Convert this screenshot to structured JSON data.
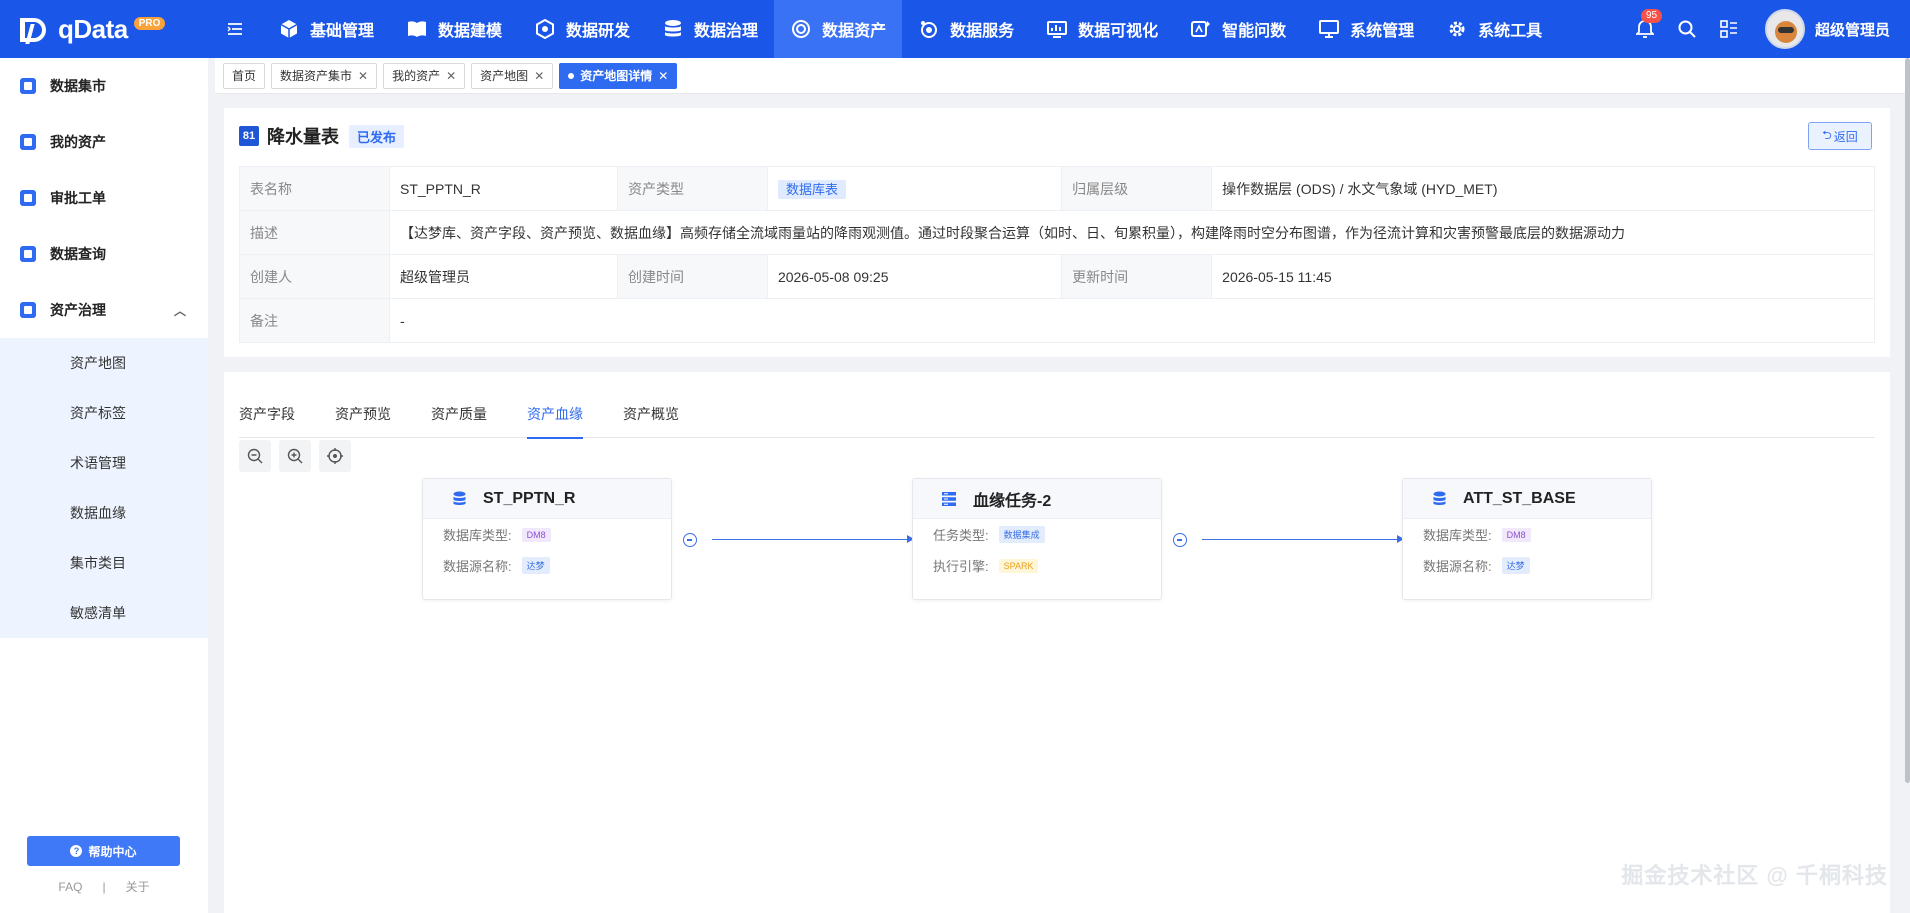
{
  "app": {
    "logo_text": "qData",
    "logo_badge": "PRO"
  },
  "nav": {
    "items": [
      {
        "label": "基础管理",
        "icon": "cube-icon"
      },
      {
        "label": "数据建模",
        "icon": "book-icon"
      },
      {
        "label": "数据研发",
        "icon": "box-icon"
      },
      {
        "label": "数据治理",
        "icon": "database-icon"
      },
      {
        "label": "数据资产",
        "icon": "target-icon",
        "active": true
      },
      {
        "label": "数据服务",
        "icon": "service-icon"
      },
      {
        "label": "数据可视化",
        "icon": "chart-icon"
      },
      {
        "label": "智能问数",
        "icon": "ai-icon"
      },
      {
        "label": "系统管理",
        "icon": "monitor-icon"
      },
      {
        "label": "系统工具",
        "icon": "gear-icon"
      }
    ],
    "notification_count": "95",
    "user_name": "超级管理员"
  },
  "sidebar": {
    "items": [
      {
        "label": "数据集市",
        "icon": "market-icon"
      },
      {
        "label": "我的资产",
        "icon": "asset-icon"
      },
      {
        "label": "审批工单",
        "icon": "approve-icon"
      },
      {
        "label": "数据查询",
        "icon": "query-icon"
      },
      {
        "label": "资产治理",
        "icon": "govern-icon",
        "expanded": true
      }
    ],
    "sub_items": [
      "资产地图",
      "资产标签",
      "术语管理",
      "数据血缘",
      "集市类目",
      "敏感清单"
    ],
    "help_label": "帮助中心",
    "faq_label": "FAQ",
    "separator": "|",
    "about_label": "关于"
  },
  "tabs": [
    {
      "label": "首页",
      "closable": false
    },
    {
      "label": "数据资产集市",
      "closable": true
    },
    {
      "label": "我的资产",
      "closable": true
    },
    {
      "label": "资产地图",
      "closable": true
    },
    {
      "label": "资产地图详情",
      "closable": true,
      "active": true
    }
  ],
  "detail": {
    "icon_text": "81",
    "title": "降水量表",
    "status": "已发布",
    "back_label": "返回",
    "fields": {
      "table_name_label": "表名称",
      "table_name": "ST_PPTN_R",
      "asset_type_label": "资产类型",
      "asset_type": "数据库表",
      "level_label": "归属层级",
      "level": "操作数据层 (ODS) / 水文气象域 (HYD_MET)",
      "desc_label": "描述",
      "desc": "【达梦库、资产字段、资产预览、数据血缘】高频存储全流域雨量站的降雨观测值。通过时段聚合运算（如时、日、旬累积量），构建降雨时空分布图谱，作为径流计算和灾害预警最底层的数据源动力",
      "creator_label": "创建人",
      "creator": "超级管理员",
      "created_label": "创建时间",
      "created": "2026-05-08 09:25",
      "updated_label": "更新时间",
      "updated": "2026-05-15 11:45",
      "remark_label": "备注",
      "remark": "-"
    }
  },
  "sub_tabs": [
    {
      "label": "资产字段"
    },
    {
      "label": "资产预览"
    },
    {
      "label": "资产质量"
    },
    {
      "label": "资产血缘",
      "active": true
    },
    {
      "label": "资产概览"
    }
  ],
  "lineage": {
    "nodes": [
      {
        "title": "ST_PPTN_R",
        "icon": "database-icon",
        "rows": [
          {
            "label": "数据库类型:",
            "value": "DM8",
            "style": "dm"
          },
          {
            "label": "数据源名称:",
            "value": "达梦",
            "style": "blue"
          }
        ]
      },
      {
        "title": "血缘任务-2",
        "icon": "task-icon",
        "rows": [
          {
            "label": "任务类型:",
            "value": "数据集成",
            "style": "blue"
          },
          {
            "label": "执行引擎:",
            "value": "SPARK",
            "style": "spark"
          }
        ]
      },
      {
        "title": "ATT_ST_BASE",
        "icon": "database-icon",
        "rows": [
          {
            "label": "数据库类型:",
            "value": "DM8",
            "style": "dm"
          },
          {
            "label": "数据源名称:",
            "value": "达梦",
            "style": "blue"
          }
        ]
      }
    ]
  },
  "watermark": "掘金技术社区 @ 千桐科技",
  "colors": {
    "primary": "#1a56e8",
    "accent": "#2f6bf0",
    "edge": "#3b6fe6"
  }
}
